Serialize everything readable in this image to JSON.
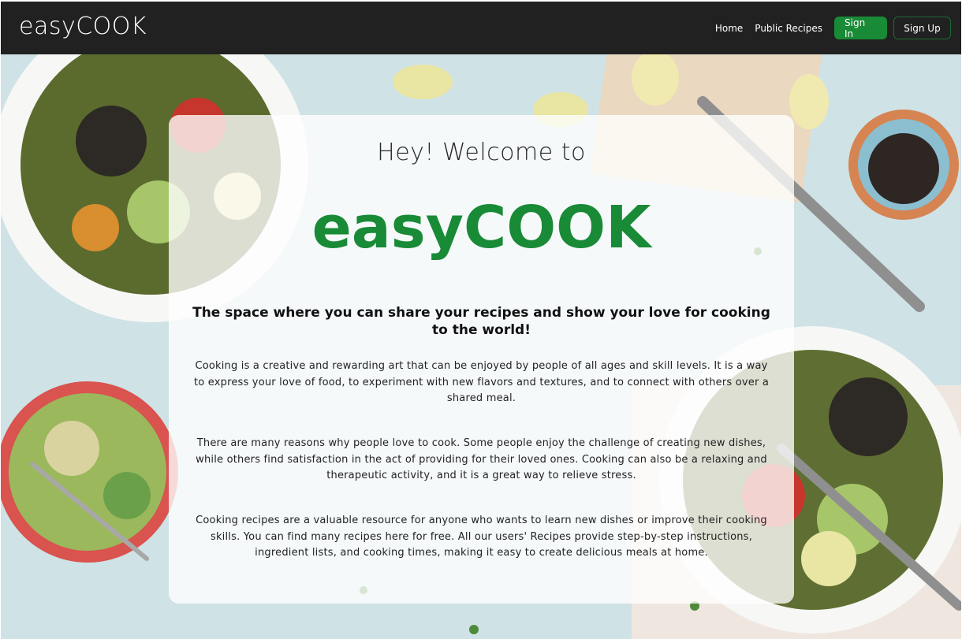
{
  "navbar": {
    "brand": "easyCOOK",
    "links": [
      "Home",
      "Public Recipes"
    ],
    "sign_in": "Sign In",
    "sign_up": "Sign Up"
  },
  "hero": {
    "welcome": "Hey! Welcome to",
    "title": "easyCOOK",
    "tagline": "The space where you can share your recipes and show your love for cooking to the world!",
    "paragraphs": [
      "Cooking is a creative and rewarding art that can be enjoyed by people of all ages and skill levels. It is a way to express your love of food, to experiment with new flavors and textures, and to connect with others over a shared meal.",
      "There are many reasons why people love to cook. Some people enjoy the challenge of creating new dishes, while others find satisfaction in the act of providing for their loved ones. Cooking can also be a relaxing and therapeutic activity, and it is a great way to relieve stress.",
      "Cooking recipes are a valuable resource for anyone who wants to learn new dishes or improve their cooking skills. You can find many recipes here for free. All our users' Recipes provide step-by-step instructions, ingredient lists, and cooking times, making it easy to create delicious meals at home."
    ]
  },
  "colors": {
    "navbar_bg": "#212121",
    "accent_green": "#198a36",
    "background_blue": "#cfe2e6"
  }
}
